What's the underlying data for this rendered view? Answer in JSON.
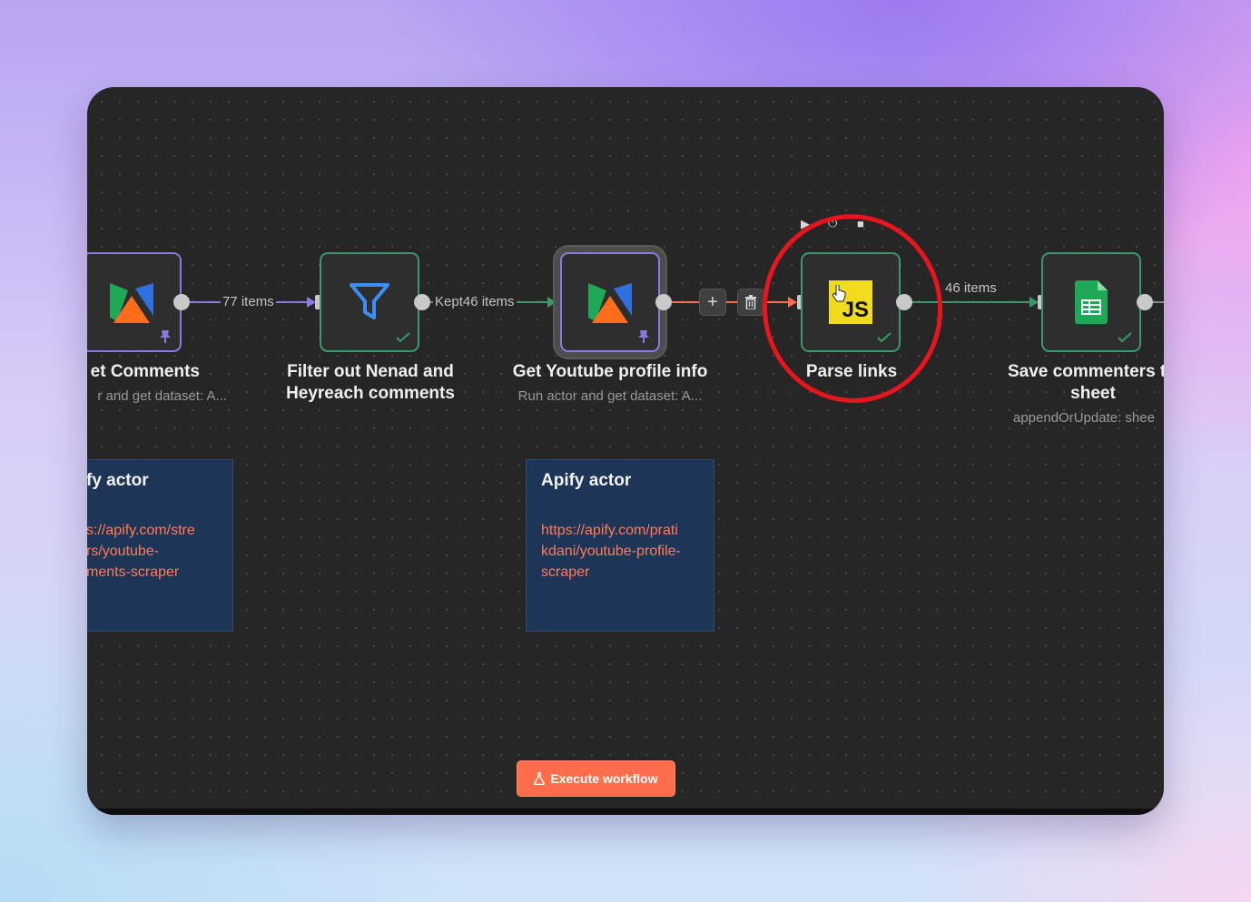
{
  "workflow": {
    "nodes": [
      {
        "title": "et Comments",
        "subtitle": "r and get dataset: A...",
        "icon": "apify-icon",
        "pinned": true
      },
      {
        "title_lines": [
          "Filter out Nenad and",
          "Heyreach comments"
        ],
        "icon": "filter-icon",
        "status": "success"
      },
      {
        "title": "Get Youtube profile info",
        "subtitle": "Run actor and get dataset: A...",
        "icon": "apify-icon",
        "pinned": true,
        "selected": true
      },
      {
        "title": "Parse links",
        "icon": "js-icon",
        "icon_text": "JS",
        "status": "success",
        "highlighted": true
      },
      {
        "title_lines": [
          "Save commenters t",
          "sheet"
        ],
        "subtitle": "appendOrUpdate: shee",
        "icon": "google-sheets-icon",
        "status": "success"
      }
    ],
    "edges": [
      {
        "label": "77 items"
      },
      {
        "label": "Kept46 items"
      },
      {
        "label": ""
      },
      {
        "label": "46 items"
      }
    ],
    "edge_actions": {
      "add": "+",
      "delete": "trash-icon"
    },
    "node_toolbar": [
      "play-icon",
      "power-icon",
      "stop-icon",
      "more-icon"
    ],
    "notes": [
      {
        "title": "fy actor",
        "link_lines": [
          "s://apify.com/stre",
          "rs/youtube-",
          "ments-scraper"
        ]
      },
      {
        "title": "Apify actor",
        "link_lines": [
          "https://apify.com/prati",
          "kdani/youtube-profile-",
          "scraper"
        ]
      }
    ],
    "execute_button": {
      "label": "Execute workflow",
      "icon": "flask-icon"
    },
    "colors": {
      "accent": "#ff6d4a",
      "success": "#3b9a68",
      "pinned": "#8b7ae0",
      "highlight": "#e8141e",
      "note_bg": "#1d3557",
      "link": "#ff7b5c"
    }
  }
}
